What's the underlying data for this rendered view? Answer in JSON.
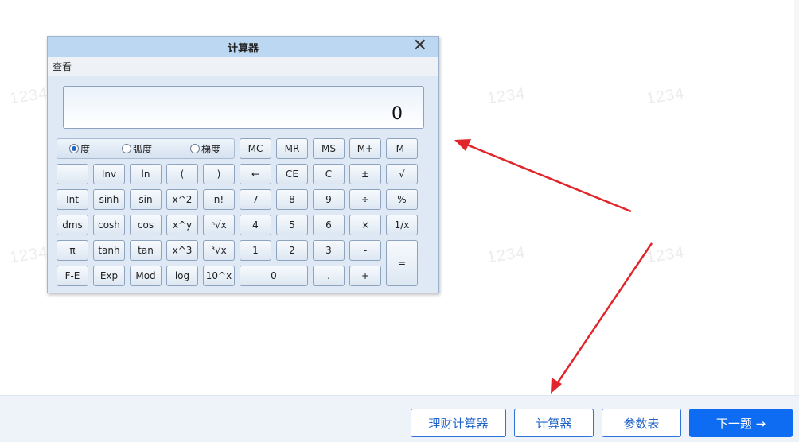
{
  "watermark": {
    "text": "1234"
  },
  "calculator": {
    "title": "计算器",
    "close_glyph": "✕",
    "menu": {
      "view": "查看"
    },
    "display": "0",
    "modes": [
      {
        "label": "度",
        "checked": true
      },
      {
        "label": "弧度",
        "checked": false
      },
      {
        "label": "梯度",
        "checked": false
      }
    ],
    "memory_row": [
      "MC",
      "MR",
      "MS",
      "M+",
      "M-"
    ],
    "rows": [
      [
        "",
        "Inv",
        "ln",
        "(",
        ")",
        "←",
        "CE",
        "C",
        "±",
        "√"
      ],
      [
        "Int",
        "sinh",
        "sin",
        "x^2",
        "n!",
        "7",
        "8",
        "9",
        "÷",
        "%"
      ],
      [
        "dms",
        "cosh",
        "cos",
        "x^y",
        "ⁿ√x",
        "4",
        "5",
        "6",
        "×",
        "1/x"
      ],
      [
        "π",
        "tanh",
        "tan",
        "x^3",
        "³√x",
        "1",
        "2",
        "3",
        "-",
        "="
      ],
      [
        "F-E",
        "Exp",
        "Mod",
        "log",
        "10^x",
        "0",
        ".",
        "+"
      ]
    ]
  },
  "footer": {
    "finance_calc": "理财计算器",
    "calculator": "计算器",
    "param_table": "参数表",
    "next": "下一题 →"
  },
  "annotation_color": "#e0262b"
}
